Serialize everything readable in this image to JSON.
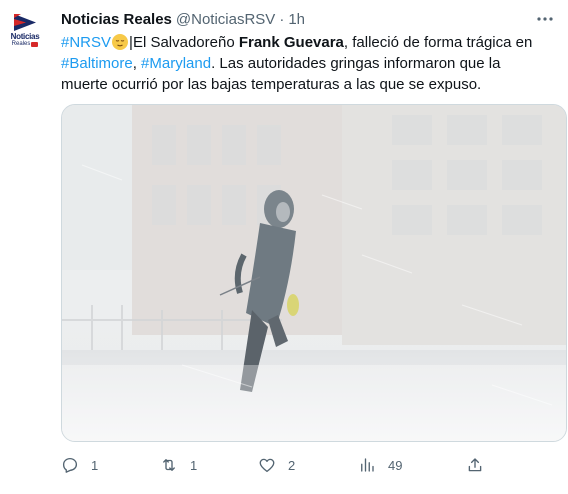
{
  "tweet": {
    "display_name": "Noticias Reales",
    "handle": "@NoticiasRSV",
    "separator": "·",
    "time": "1h",
    "avatar": {
      "line1": "Noticias",
      "line2": "Reales"
    },
    "text": {
      "hashtag1": "#NRSV",
      "separator": "|",
      "part1": "El Salvadoreño ",
      "bold_name": "Frank Guevara",
      "part2": ", falleció de forma trágica en ",
      "hashtag2": "#Baltimore",
      "comma": ", ",
      "hashtag3": "#Maryland",
      "part3": ". Las autoridades gringas informaron que la muerte ocurrió por las bajas temperaturas a las que se expuso."
    },
    "emoji": "relieved-face",
    "link_color": "#1d9bf0",
    "actions": {
      "replies": "1",
      "retweets": "1",
      "likes": "2",
      "views": "49"
    }
  },
  "icons": {
    "more": "more-dots-icon",
    "reply": "reply-icon",
    "retweet": "retweet-icon",
    "like": "heart-icon",
    "views": "views-icon",
    "share": "share-icon"
  }
}
